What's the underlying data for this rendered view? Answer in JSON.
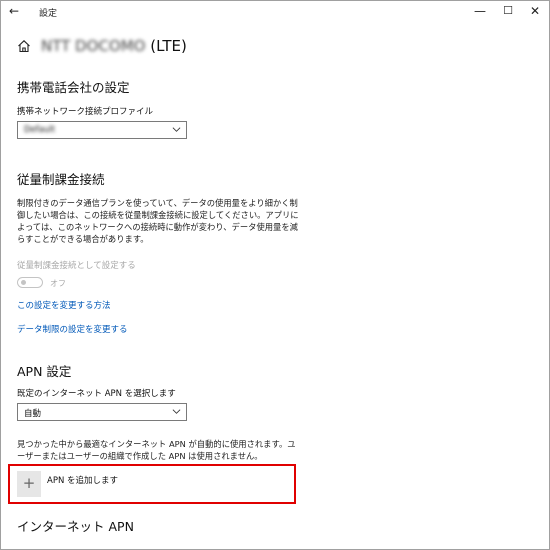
{
  "window": {
    "back_glyph": "←",
    "app_title": "設定",
    "minimize_glyph": "—",
    "maximize_glyph": "☐",
    "close_glyph": "✕"
  },
  "header": {
    "carrier_name": "NTT DOCOMO",
    "carrier_suffix": "(LTE)"
  },
  "carrier_settings": {
    "heading": "携帯電話会社の設定",
    "profile_label": "携帯ネットワーク接続プロファイル",
    "profile_value": "Default"
  },
  "metered": {
    "heading": "従量制課金接続",
    "description": "制限付きのデータ通信プランを使っていて、データの使用量をより細かく制御したい場合は、この接続を従量制課金接続に設定してください。アプリによっては、このネットワークへの接続時に動作が変わり、データ使用量を減らすことができる場合があります。",
    "toggle_label": "従量制課金接続として設定する",
    "toggle_state": "オフ",
    "link_change": "この設定を変更する方法",
    "link_data_limit": "データ制限の設定を変更する"
  },
  "apn": {
    "heading": "APN 設定",
    "default_label": "既定のインターネット APN を選択します",
    "default_value": "自動",
    "description": "見つかった中から最適なインターネット APN が自動的に使用されます。ユーザーまたはユーザーの組織で作成した APN は使用されません。",
    "add_label": "APN を追加します",
    "add_glyph": "+"
  },
  "internet_apn": {
    "heading": "インターネット APN"
  },
  "colors": {
    "link": "#0058b8",
    "highlight": "#e00000",
    "disabled_text": "#a8a8a8"
  }
}
